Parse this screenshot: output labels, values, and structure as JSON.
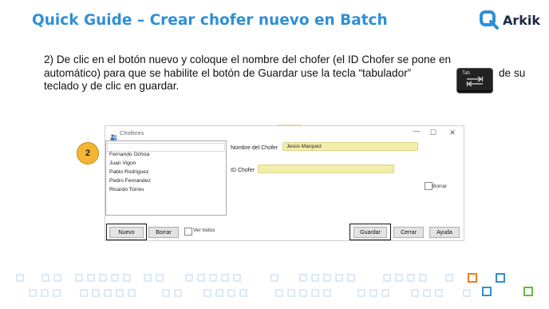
{
  "slide": {
    "title": "Quick Guide – Crear chofer nuevo en Batch",
    "logo_text": "Arkik",
    "instruction_lines": [
      "2) De clic en el botón nuevo y coloque el nombre del chofer (el ID Chofer se pone en",
      "automático) para que se habilite el botón de Guardar use la tecla “tabulador”",
      "teclado y de clic en guardar."
    ],
    "instruction_end": "de su",
    "tab_key_label": "Tab",
    "step_number": "2"
  },
  "window": {
    "title": "Choferes",
    "controls": {
      "minimize": "—",
      "maximize": "☐",
      "close": "✕"
    },
    "list_items": [
      "Fernando Ochoa",
      "Juan Vigon",
      "Pablo Rodriguez",
      "Pedro Fernandez",
      "Ricardo Torres"
    ],
    "nombre_label": "Nombre del Chofer",
    "nombre_value": "Jesús Marquez",
    "id_label": "ID Chofer",
    "id_value": "",
    "borrar_checkbox_label": "Borrar",
    "ver_todos_label": "Ver todos",
    "buttons": {
      "nuevo": "Nuevo",
      "borrar": "Borrar",
      "guardar": "Guardar",
      "cerrar": "Cerrar",
      "ayuda": "Ayuda"
    }
  },
  "colors": {
    "title_blue": "#2f8fd6",
    "field_yellow": "#f2eeaa",
    "badge_orange": "#f5b534",
    "accent_orange": "#f07c1e",
    "accent_green": "#69b843"
  },
  "icons": [
    "arkik-logo-icon",
    "tab-key-icon",
    "app-icon",
    "minimize-icon",
    "maximize-icon",
    "close-icon"
  ]
}
